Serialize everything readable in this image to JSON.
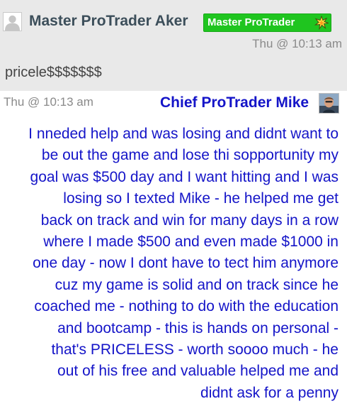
{
  "messages": [
    {
      "author": "Master ProTrader Aker",
      "badge": "Master ProTrader",
      "timestamp": "Thu @ 10:13 am",
      "text": "pricele$$$$$$$"
    },
    {
      "author": "Chief ProTrader Mike",
      "timestamp": "Thu @ 10:13 am",
      "lines": [
        "I nneded help and was losing and didnt want to",
        "be out the game and lose thi sopportunity my",
        "goal was $500 day and I want hitting and I was",
        "losing so I texted Mike - he helped me get",
        "back on track and win for many days in a row",
        "where I made $500 and even made $1000 in",
        "one day - now I dont have to tect him anymore",
        "cuz my game is solid and on track since he",
        "coached me - nothing to do with the education",
        "and bootcamp - this is hands on personal -",
        "that's PRICELESS - worth soooo much - he",
        "out of his free and valuable helped me and",
        "didnt ask for a penny"
      ]
    }
  ],
  "colors": {
    "name1": "#3c4e5a",
    "badge_bg": "#1fc51f",
    "chief_text": "#1414c8",
    "timestamp": "#8a8a8a",
    "msg1_bg": "#e9e9e9",
    "msg2_bg": "#ffffff"
  },
  "icons": {
    "msg1_avatar": "default-user-icon",
    "badge_icon": "star-burst-icon",
    "msg2_avatar": "user-photo"
  }
}
